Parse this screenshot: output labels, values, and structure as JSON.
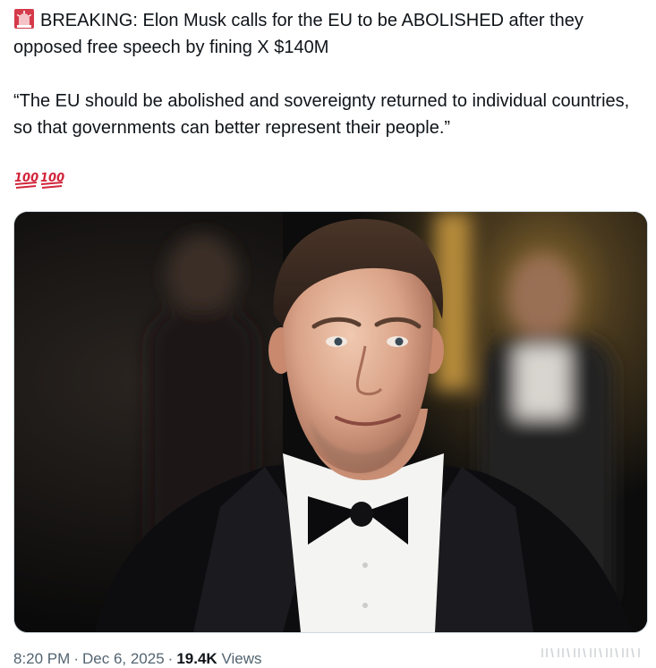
{
  "tweet": {
    "headline_prefix": "BREAKING: Elon Musk calls for the EU to be ABOLISHED after they opposed free speech by fining X $140M",
    "quote": "“The EU should be abolished and sovereignty returned to individual countries, so that governments can better represent their people.”",
    "emoji_row": [
      "hundred-points-emoji",
      "hundred-points-emoji"
    ],
    "leading_emoji": "rotating-light-emoji"
  },
  "media": {
    "image_kind": "portrait-photo",
    "subject": "man-in-tuxedo-bow-tie"
  },
  "meta": {
    "time": "8:20 PM",
    "separator": "·",
    "date": "Dec 6, 2025",
    "views_count": "19.4K",
    "views_label": "Views"
  },
  "colors": {
    "text": "#0f1419",
    "secondary": "#536471",
    "siren_red": "#e0245e",
    "hundred_red": "#d1243a"
  }
}
